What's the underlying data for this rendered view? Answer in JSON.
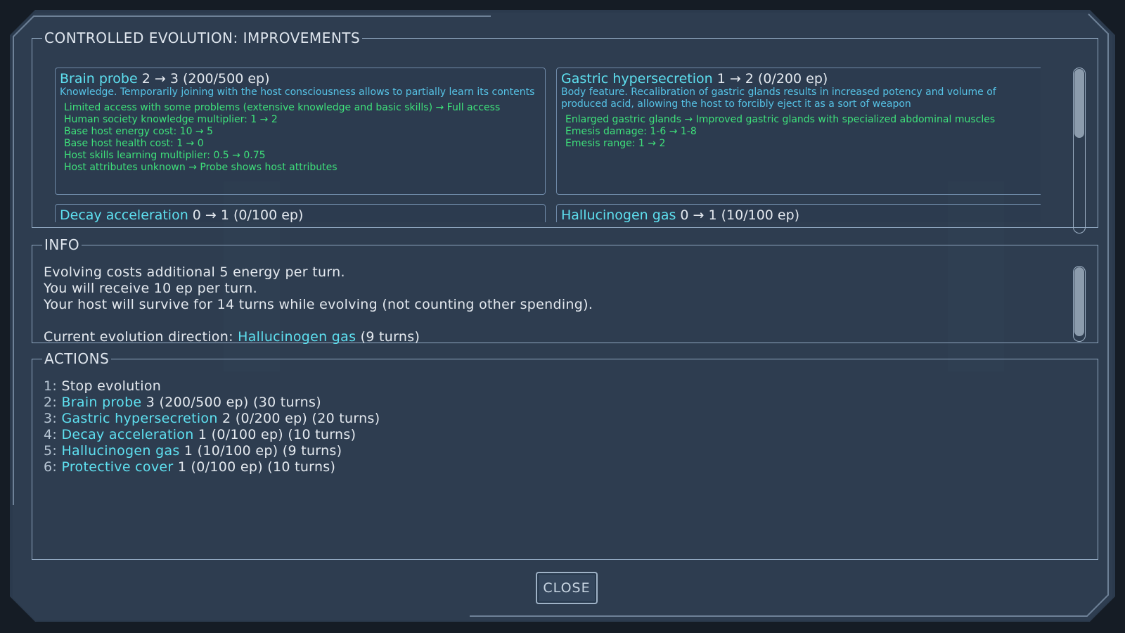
{
  "improvements": {
    "legend": "CONTROLLED EVOLUTION: IMPROVEMENTS",
    "cards": [
      {
        "name": "Brain probe",
        "progress": "2 → 3 (200/500 ep)",
        "desc": "Knowledge. Temporarily joining with the host consciousness allows to partially learn its contents",
        "effects": [
          "Limited access with some problems (extensive knowledge and basic skills) → Full access",
          "Human society knowledge multiplier: 1 → 2",
          "Base host energy cost: 10 → 5",
          "Base host health cost: 1 → 0",
          "Host skills learning multiplier: 0.5 → 0.75",
          "Host attributes unknown → Probe shows host attributes"
        ]
      },
      {
        "name": "Gastric hypersecretion",
        "progress": "1 → 2 (0/200 ep)",
        "desc": "Body feature. Recalibration of gastric glands results in increased potency and volume of produced acid, allowing the host to forcibly eject it as a sort of weapon",
        "effects": [
          "Enlarged gastric glands → Improved gastric glands with specialized abdominal muscles",
          "Emesis damage: 1-6 → 1-8",
          "Emesis range: 1 → 2"
        ]
      },
      {
        "name": "Decay acceleration",
        "progress": "0 → 1 (0/100 ep)"
      },
      {
        "name": "Hallucinogen gas",
        "progress": "0 → 1 (10/100 ep)"
      }
    ]
  },
  "info": {
    "legend": "INFO",
    "line1": "Evolving costs additional 5 energy per turn.",
    "line2": "You will receive 10 ep per turn.",
    "line3": "Your host will survive for 14 turns while evolving (not counting other spending).",
    "direction_label": "Current evolution direction: ",
    "direction_name": "Hallucinogen gas",
    "direction_turns": " (9 turns)"
  },
  "actions": {
    "legend": "ACTIONS",
    "items": [
      {
        "num": "1",
        "name": "",
        "rest": "Stop evolution"
      },
      {
        "num": "2",
        "name": "Brain probe",
        "rest": " 3 (200/500 ep) (30 turns)"
      },
      {
        "num": "3",
        "name": "Gastric hypersecretion",
        "rest": " 2 (0/200 ep) (20 turns)"
      },
      {
        "num": "4",
        "name": "Decay acceleration",
        "rest": " 1 (0/100 ep) (10 turns)"
      },
      {
        "num": "5",
        "name": "Hallucinogen gas",
        "rest": " 1 (10/100 ep) (9 turns)"
      },
      {
        "num": "6",
        "name": "Protective cover",
        "rest": " 1 (0/100 ep) (10 turns)"
      }
    ]
  },
  "close_label": "CLOSE",
  "colors": {
    "highlight": "#5ee0f0",
    "effect": "#3ee07a",
    "description": "#56c3e6"
  }
}
